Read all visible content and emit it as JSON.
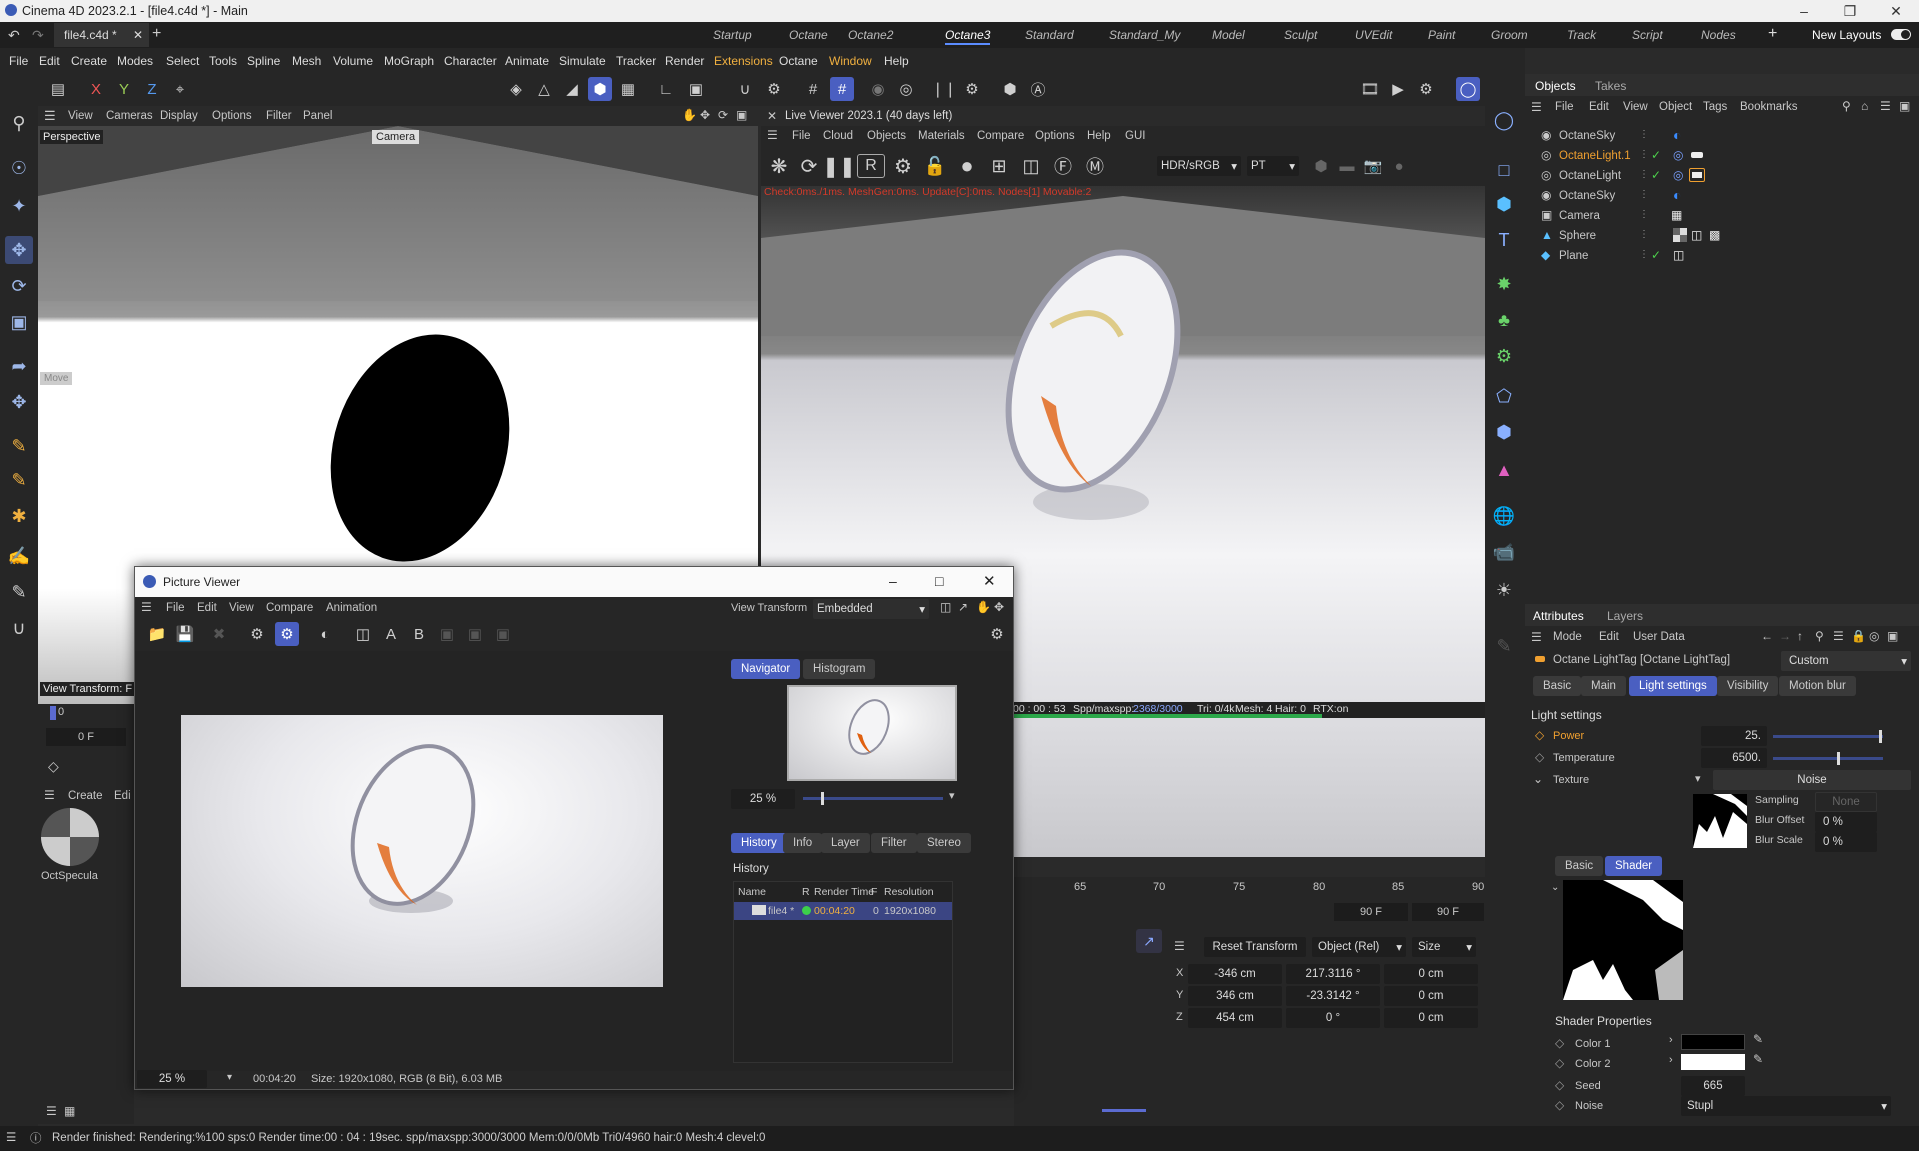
{
  "window": {
    "title": "Cinema 4D 2023.2.1 - [file4.c4d *] - Main"
  },
  "tabs": {
    "doc": "file4.c4d *",
    "layouts": [
      "Startup",
      "Octane",
      "Octane2",
      "Octane3",
      "Standard",
      "Standard_My",
      "Model",
      "Sculpt",
      "UVEdit",
      "Paint",
      "Groom",
      "Track",
      "Script",
      "Nodes"
    ],
    "new_layouts": "New Layouts"
  },
  "menu": [
    "File",
    "Edit",
    "Create",
    "Modes",
    "Select",
    "Tools",
    "Spline",
    "Mesh",
    "Volume",
    "MoGraph",
    "Character",
    "Animate",
    "Simulate",
    "Tracker",
    "Render",
    "Extensions",
    "Octane",
    "Window",
    "Help"
  ],
  "toolbar": {
    "axes": [
      "X",
      "Y",
      "Z"
    ]
  },
  "viewport": {
    "menu": [
      "View",
      "Cameras",
      "Display",
      "Options",
      "Filter",
      "Panel"
    ],
    "label": "Perspective",
    "camera": "Camera",
    "move": "Move",
    "view_transform": "View Transform: F",
    "frame": "0 F",
    "tick0": "0",
    "create": "Create",
    "edit": "Edi",
    "material_name": "OctSpecula"
  },
  "live_viewer": {
    "title": "Live Viewer 2023.1 (40 days left)",
    "menu": [
      "File",
      "Cloud",
      "Objects",
      "Materials",
      "Compare",
      "Options",
      "Help",
      "GUI"
    ],
    "color_mode": "HDR/sRGB",
    "mode": "PT",
    "stats": "Check:0ms./1ms. MeshGen:0ms. Update[C]:0ms. Nodes[1] Movable:2",
    "progress_text": "00 : 00 : 53",
    "spp_label": "Spp/maxspp:",
    "spp": "2368/3000",
    "tri": "Tri: 0/4k",
    "mesh": "Mesh: 4",
    "hair": "Hair: 0",
    "rtx": "RTX:on",
    "progress": 0.79
  },
  "timeline": {
    "ticks": [
      "65",
      "70",
      "75",
      "80",
      "85",
      "90"
    ],
    "end1": "90 F",
    "end2": "90 F"
  },
  "coords": {
    "reset": "Reset Transform",
    "space": "Object (Rel)",
    "mode": "Size",
    "rows": [
      {
        "axis": "X",
        "pos": "-346 cm",
        "rot": "217.3116 °",
        "size": "0 cm"
      },
      {
        "axis": "Y",
        "pos": "346 cm",
        "rot": "-23.3142 °",
        "size": "0 cm"
      },
      {
        "axis": "Z",
        "pos": "454 cm",
        "rot": "0 °",
        "size": "0 cm"
      }
    ]
  },
  "picture_viewer": {
    "title": "Picture Viewer",
    "menu": [
      "File",
      "Edit",
      "View",
      "Compare",
      "Animation"
    ],
    "view_transform_label": "View Transform",
    "view_transform": "Embedded",
    "tabs": [
      "Navigator",
      "Histogram"
    ],
    "zoom": "25 %",
    "lower_tabs": [
      "History",
      "Info",
      "Layer",
      "Filter",
      "Stereo"
    ],
    "history_title": "History",
    "cols": [
      "Name",
      "R",
      "Render Time",
      "F",
      "Resolution"
    ],
    "row": {
      "name": "file4 *",
      "time": "00:04:20",
      "frame": "0",
      "res": "1920x1080"
    },
    "footer_zoom": "25 %",
    "footer_time": "00:04:20",
    "footer_info": "Size: 1920x1080, RGB (8 Bit), 6.03 MB"
  },
  "objects_panel": {
    "tabs": [
      "Objects",
      "Takes"
    ],
    "menu": [
      "File",
      "Edit",
      "View",
      "Object",
      "Tags",
      "Bookmarks"
    ],
    "items": [
      {
        "name": "OctaneSky",
        "color": "#cfcfcf"
      },
      {
        "name": "OctaneLight.1",
        "color": "#f0a030"
      },
      {
        "name": "OctaneLight",
        "color": "#cfcfcf"
      },
      {
        "name": "OctaneSky",
        "color": "#cfcfcf"
      },
      {
        "name": "Camera",
        "color": "#cfcfcf"
      },
      {
        "name": "Sphere",
        "color": "#cfcfcf"
      },
      {
        "name": "Plane",
        "color": "#cfcfcf"
      }
    ]
  },
  "attributes": {
    "tabs": [
      "Attributes",
      "Layers"
    ],
    "menu": [
      "Mode",
      "Edit",
      "User Data"
    ],
    "tag": "Octane LightTag [Octane LightTag]",
    "preset": "Custom",
    "subtabs": [
      "Basic",
      "Main",
      "Light settings",
      "Visibility",
      "Motion blur"
    ],
    "section": "Light settings",
    "power_label": "Power",
    "power": "25.",
    "power_frac": 0.96,
    "temp_label": "Temperature",
    "temp": "6500.",
    "temp_frac": 0.58,
    "texture_label": "Texture",
    "texture": "Noise",
    "sampling_label": "Sampling",
    "sampling": "None",
    "blur_offset_label": "Blur Offset",
    "blur_offset": "0 %",
    "blur_scale_label": "Blur Scale",
    "blur_scale": "0 %",
    "shader_tabs": [
      "Basic",
      "Shader"
    ],
    "shader_props": "Shader Properties",
    "color1": "Color 1",
    "color2": "Color 2",
    "seed_label": "Seed",
    "seed": "665",
    "noise_label": "Noise",
    "noise": "Stupl"
  },
  "status": "Render finished: Rendering:%100 sps:0 Render time:00 : 04 : 19sec. spp/maxspp:3000/3000 Mem:0/0/0Mb Tri0/4960 hair:0 Mesh:4 clevel:0"
}
